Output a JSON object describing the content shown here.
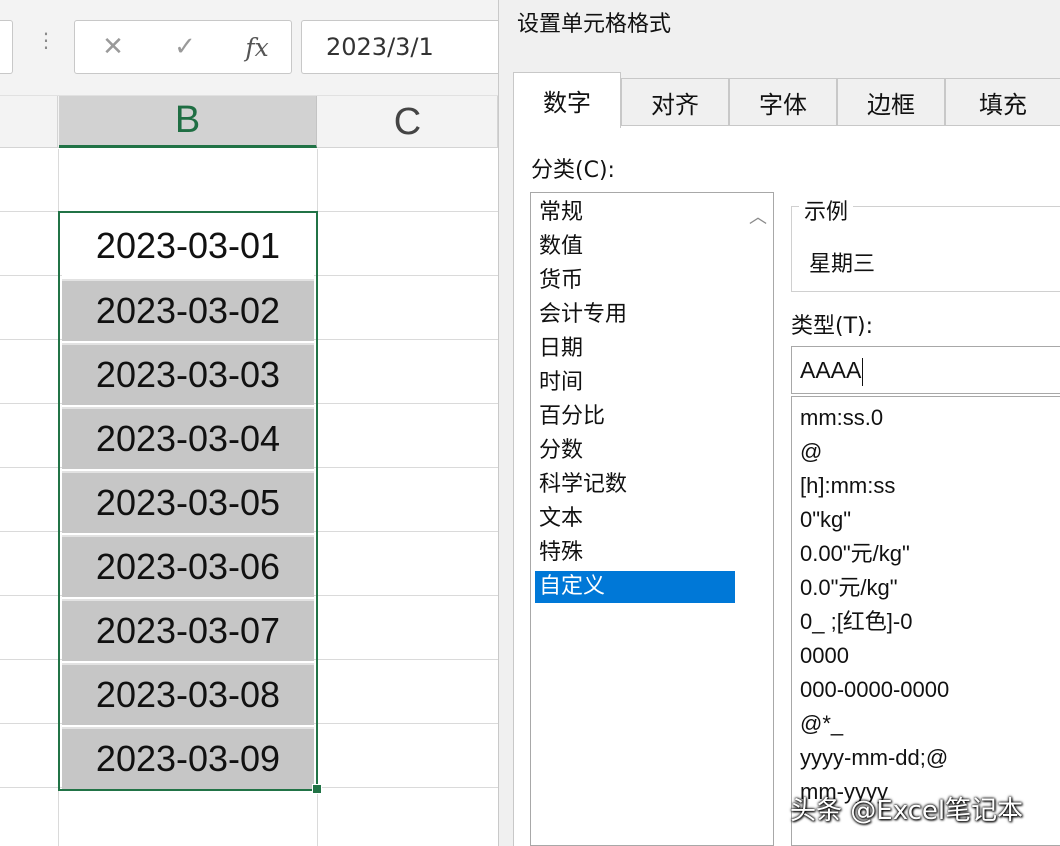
{
  "formula_bar": {
    "cancel_icon": "✕",
    "enter_icon": "✓",
    "fx_label": "fx",
    "content": "2023/3/1"
  },
  "columns": [
    "B",
    "C"
  ],
  "cells": [
    "2023-03-01",
    "2023-03-02",
    "2023-03-03",
    "2023-03-04",
    "2023-03-05",
    "2023-03-06",
    "2023-03-07",
    "2023-03-08",
    "2023-03-09"
  ],
  "dialog": {
    "title": "设置单元格格式",
    "tabs": [
      "数字",
      "对齐",
      "字体",
      "边框",
      "填充"
    ],
    "active_tab": "数字",
    "category_label": "分类(C):",
    "categories": [
      "常规",
      "数值",
      "货币",
      "会计专用",
      "日期",
      "时间",
      "百分比",
      "分数",
      "科学记数",
      "文本",
      "特殊",
      "自定义"
    ],
    "selected_category": "自定义",
    "sample_label": "示例",
    "sample_value": "星期三",
    "type_label": "类型(T):",
    "type_value": "AAAA",
    "type_list": [
      "mm:ss.0",
      "@",
      "[h]:mm:ss",
      "0\"kg\"",
      "0.00\"元/kg\"",
      "0.0\"元/kg\"",
      "0_ ;[红色]-0",
      "0000",
      "000-0000-0000",
      "@*_",
      "yyyy-mm-dd;@",
      "mm-yyyy"
    ]
  },
  "watermark": "头条 @Excel笔记本",
  "colors": {
    "excel_green": "#217346",
    "selection_blue": "#0078d7",
    "selected_cell_fill": "#c6c6c6"
  }
}
